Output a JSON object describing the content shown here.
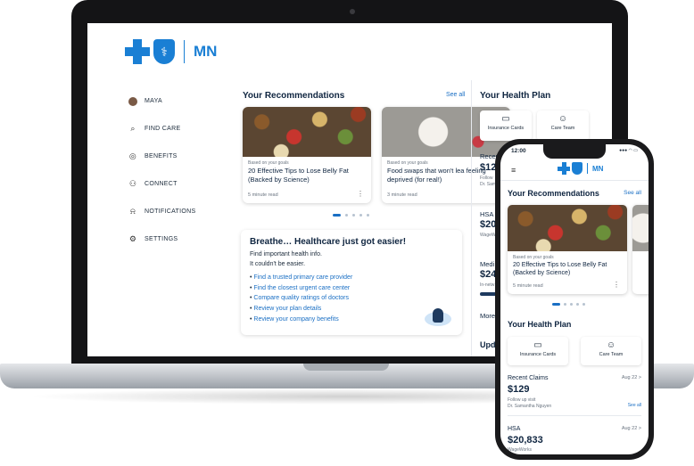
{
  "brand": {
    "mn": "MN",
    "primary_color": "#1a7fd4",
    "dark_text": "#0f2540",
    "link_color": "#1a6fc4"
  },
  "sidebar": {
    "items": [
      {
        "label": "MAYA",
        "icon": "avatar"
      },
      {
        "label": "FIND CARE",
        "icon": "search-icon"
      },
      {
        "label": "BENEFITS",
        "icon": "benefits-icon"
      },
      {
        "label": "CONNECT",
        "icon": "people-icon"
      },
      {
        "label": "NOTIFICATIONS",
        "icon": "bell-icon"
      },
      {
        "label": "SETTINGS",
        "icon": "gear-icon"
      }
    ]
  },
  "recommendations": {
    "title": "Your Recommendations",
    "see_all": "See all",
    "cards": [
      {
        "meta": "Based on your goals",
        "title": "20 Effective Tips to Lose Belly Fat (Backed by Science)",
        "read": "5 minute read"
      },
      {
        "meta": "Based on your goals",
        "title": "Food swaps that won't lea feeling deprived (for real!)",
        "read": "3 minute read"
      }
    ]
  },
  "breathe": {
    "title": "Breathe… Healthcare just got easier!",
    "line1": "Find important health info.",
    "line2": "It couldn't be easier.",
    "links": [
      "Find a trusted primary care provider",
      "Find the closest urgent care center",
      "Compare quality ratings of doctors",
      "Review your plan details",
      "Review your company benefits"
    ]
  },
  "health_plan": {
    "title": "Your Health Plan",
    "tiles": [
      "Insurance Cards",
      "Care Team"
    ],
    "recent_label": "Recent",
    "recent_val": "$129",
    "recent_sub1": "Follow",
    "recent_sub2": "Dr. Sam",
    "hsa_label": "HSA",
    "hsa_val": "$20,",
    "hsa_sub": "WageW",
    "medi_label": "Medi",
    "medi_val": "$24",
    "medi_sub": "In-netw",
    "more_label": "More",
    "upd_label": "Upd"
  },
  "phone": {
    "time": "12:00",
    "status": "●●● ◠ ▭",
    "rec_title": "Your Recommendations",
    "see_all": "See all",
    "card": {
      "meta": "Based on your goals",
      "title": "20 Effective Tips to Lose Belly Fat (Backed by Science)",
      "read": "5 minute read"
    },
    "hp_title": "Your Health Plan",
    "tiles": [
      "Insurance Cards",
      "Care Team"
    ],
    "claims": {
      "label": "Recent Claims",
      "date": "Aug 22 >",
      "value": "$129",
      "sub1": "Follow up visit",
      "sub2": "Dr. Samantha Nguyen",
      "see_all": "See all"
    },
    "hsa": {
      "label": "HSA",
      "date": "Aug 22 >",
      "value": "$20,833",
      "sub": "WageWorks"
    }
  }
}
